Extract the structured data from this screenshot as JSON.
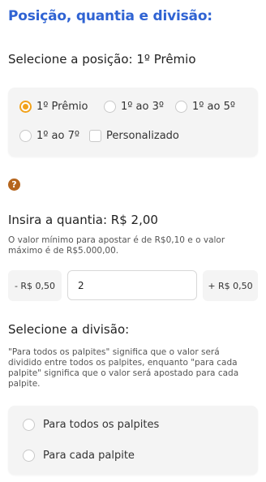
{
  "title": "Posição, quantia e divisão:",
  "position": {
    "heading": "Selecione a posição: 1º Prêmio",
    "options": [
      "1º Prêmio",
      "1º ao 3º",
      "1º ao 5º",
      "1º ao 7º"
    ],
    "selected": "1º Prêmio",
    "custom_label": "Personalizado",
    "help_icon": "question-circle-icon",
    "help_color": "#b5651d",
    "accent": "#f2a21b"
  },
  "amount": {
    "heading": "Insira a quantia: R$ 2,00",
    "note": "O valor mínimo para apostar é de R$0,10 e o valor máximo é de R$5.000,00.",
    "decrease_label": "- R$ 0,50",
    "value": "2",
    "increase_label": "+ R$ 0,50"
  },
  "division": {
    "heading": "Selecione a divisão:",
    "note": "\"Para todos os palpites\" significa que o valor será dividido entre todos os palpites, enquanto \"para cada palpite\" significa que o valor será apostado para cada palpite.",
    "options": [
      "Para todos os palpites",
      "Para cada palpite"
    ]
  }
}
